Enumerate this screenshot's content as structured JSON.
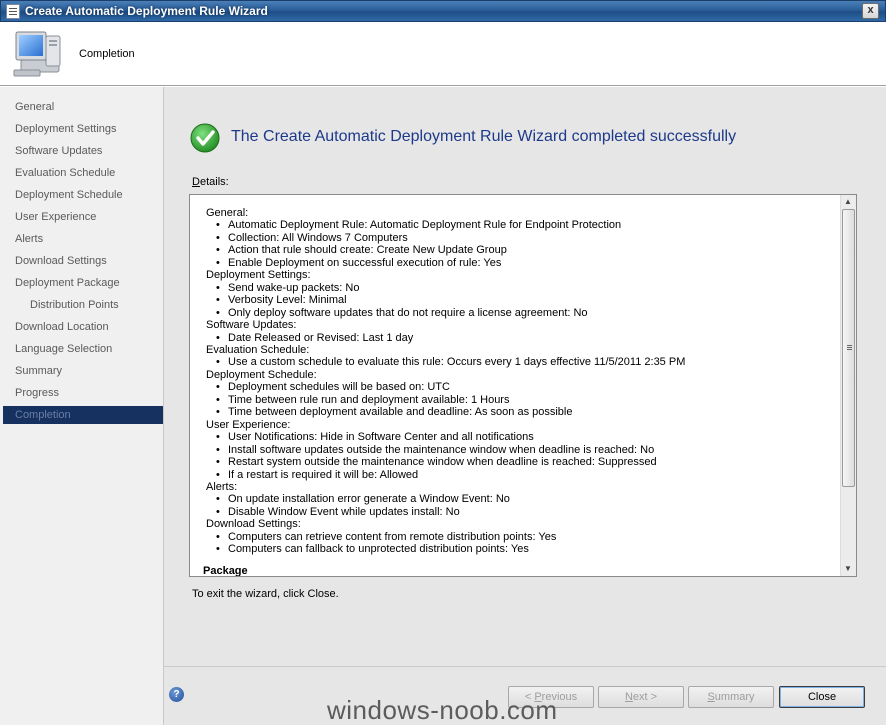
{
  "window": {
    "title": "Create Automatic Deployment Rule Wizard",
    "close_glyph": "x"
  },
  "header": {
    "page_heading": "Completion",
    "icon": "computer-icon"
  },
  "sidebar": {
    "items": [
      {
        "label": "General"
      },
      {
        "label": "Deployment Settings"
      },
      {
        "label": "Software Updates"
      },
      {
        "label": "Evaluation Schedule"
      },
      {
        "label": "Deployment Schedule"
      },
      {
        "label": "User Experience"
      },
      {
        "label": "Alerts"
      },
      {
        "label": "Download Settings"
      },
      {
        "label": "Deployment Package"
      },
      {
        "label": "Distribution Points"
      },
      {
        "label": "Download Location"
      },
      {
        "label": "Language Selection"
      },
      {
        "label": "Summary"
      },
      {
        "label": "Progress"
      },
      {
        "label": "Completion"
      }
    ],
    "active": "Completion"
  },
  "main": {
    "success_title": "The Create Automatic Deployment Rule Wizard completed successfully",
    "details_label_underlined": "D",
    "details_label_rest": "etails:",
    "details": {
      "s0": "General:",
      "s0_items": [
        "Automatic Deployment Rule: Automatic Deployment Rule for Endpoint Protection",
        "Collection: All Windows 7 Computers",
        "Action that rule should create: Create New Update Group",
        "Enable Deployment on successful execution of rule: Yes"
      ],
      "s1": "Deployment Settings:",
      "s1_items": [
        "Send wake-up packets: No",
        "Verbosity Level: Minimal",
        "Only deploy software updates that do not require a license agreement: No"
      ],
      "s2": "Software Updates:",
      "s2_items": [
        "Date Released or Revised: Last 1 day"
      ],
      "s3": "Evaluation Schedule:",
      "s3_items": [
        "Use a custom schedule to evaluate this rule: Occurs every 1 days effective 11/5/2011 2:35 PM"
      ],
      "s4": "Deployment Schedule:",
      "s4_items": [
        "Deployment schedules will be based on: UTC",
        "Time between rule run and deployment available: 1 Hours",
        "Time between deployment available and deadline: As soon as possible"
      ],
      "s5": "User Experience:",
      "s5_items": [
        "User Notifications: Hide in Software Center and all notifications",
        "Install software updates outside the maintenance window when deadline is reached: No",
        "Restart system outside the maintenance window when deadline is reached: Suppressed",
        "If a restart is required it will be: Allowed"
      ],
      "s6": "Alerts:",
      "s6_items": [
        "On update installation error generate a Window Event: No",
        "Disable Window Event while updates install: No"
      ],
      "s7": "Download Settings:",
      "s7_items": [
        "Computers can retrieve content from remote distribution points: Yes",
        "Computers can fallback to unprotected distribution points: Yes"
      ],
      "package_heading": "Package"
    },
    "exit_text": "To exit the wizard, click Close."
  },
  "footer": {
    "help_glyph": "?",
    "previous": {
      "pre": "< ",
      "mnemonic": "P",
      "post": "revious"
    },
    "next": {
      "pre": "",
      "mnemonic": "N",
      "post": "ext >"
    },
    "summary": {
      "pre": "",
      "mnemonic": "S",
      "post": "ummary"
    },
    "close_label": "Close"
  },
  "watermark": "windows-noob.com",
  "colors": {
    "titlebar": "#2b5f99",
    "active_nav": "#16305f",
    "success_title": "#1d3a8a",
    "success_green": "#2e9e2e"
  }
}
